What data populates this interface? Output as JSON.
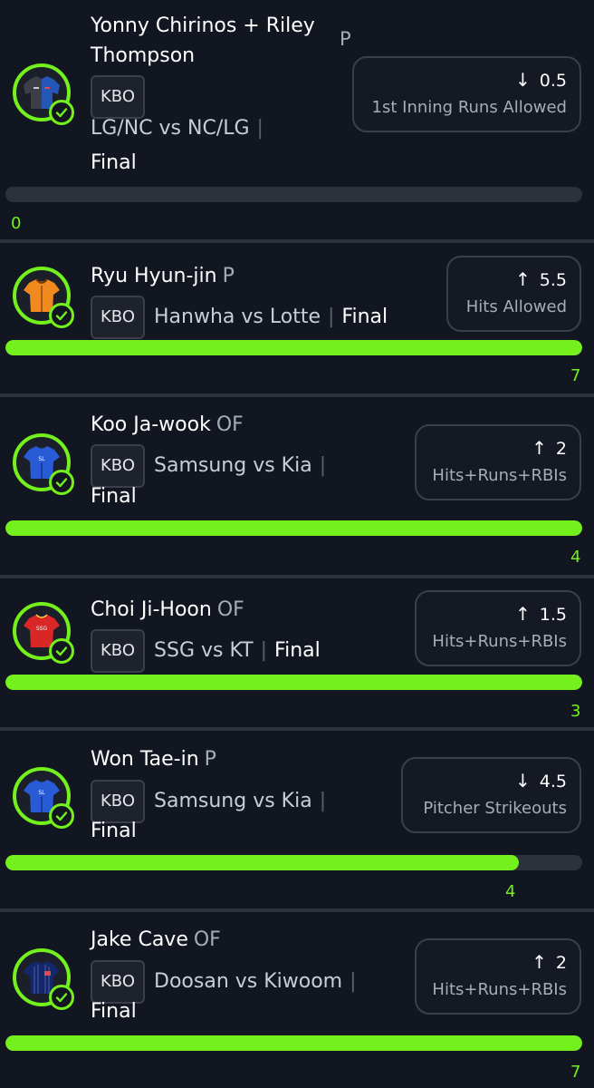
{
  "colors": {
    "accent": "#74f01c",
    "background": "#121620",
    "track": "#2d313b"
  },
  "picks": [
    {
      "player": "Yonny Chirinos + Riley Thompson",
      "player_line1": "Yonny Chirinos + Riley",
      "player_line2": "Thompson",
      "position": "P",
      "league": "KBO",
      "matchup": "LG/NC vs NC/LG",
      "status": "Final",
      "direction": "down",
      "arrow": "↓",
      "line": "0.5",
      "stat": "1st Inning Runs Allowed",
      "result": "0",
      "progress": 0.0,
      "jersey": "split-jersey-icon"
    },
    {
      "player": "Ryu Hyun-jin",
      "position": "P",
      "league": "KBO",
      "matchup": "Hanwha vs Lotte",
      "status": "Final",
      "direction": "up",
      "arrow": "↑",
      "line": "5.5",
      "stat": "Hits Allowed",
      "result": "7",
      "progress": 1.0,
      "jersey": "orange-jersey-icon"
    },
    {
      "player": "Koo Ja-wook",
      "position": "OF",
      "league": "KBO",
      "matchup": "Samsung vs Kia",
      "status": "Final",
      "direction": "up",
      "arrow": "↑",
      "line": "2",
      "stat": "Hits+Runs+RBIs",
      "result": "4",
      "progress": 1.0,
      "jersey": "blue-jersey-icon"
    },
    {
      "player": "Choi Ji-Hoon",
      "position": "OF",
      "league": "KBO",
      "matchup": "SSG vs KT",
      "status": "Final",
      "direction": "up",
      "arrow": "↑",
      "line": "1.5",
      "stat": "Hits+Runs+RBIs",
      "result": "3",
      "progress": 1.0,
      "jersey": "red-jersey-icon"
    },
    {
      "player": "Won Tae-in",
      "position": "P",
      "league": "KBO",
      "matchup": "Samsung vs Kia",
      "status": "Final",
      "direction": "down",
      "arrow": "↓",
      "line": "4.5",
      "stat": "Pitcher Strikeouts",
      "result": "4",
      "progress": 0.89,
      "jersey": "blue-jersey-icon"
    },
    {
      "player": "Jake Cave",
      "position": "OF",
      "league": "KBO",
      "matchup": "Doosan vs Kiwoom",
      "status": "Final",
      "direction": "up",
      "arrow": "↑",
      "line": "2",
      "stat": "Hits+Runs+RBIs",
      "result": "7",
      "progress": 1.0,
      "jersey": "navy-jersey-icon"
    }
  ]
}
